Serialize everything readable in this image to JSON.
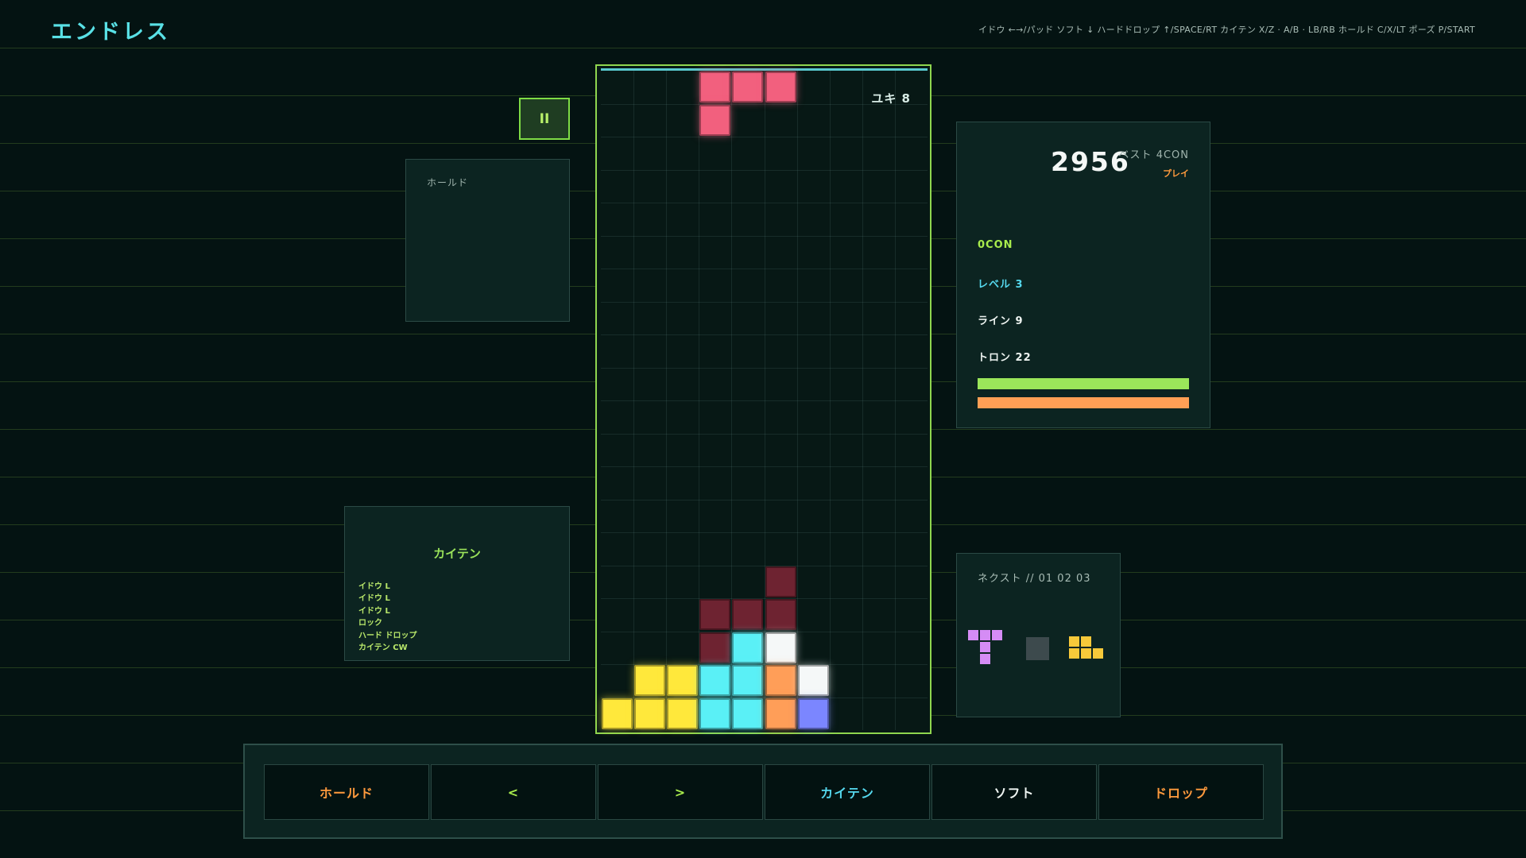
{
  "header": {
    "title": "エンドレス",
    "controls_hint": "イドウ ←→/パッド ソフト ↓ ハードドロップ ↑/SPACE/RT カイテン X/Z · A/B · LB/RB ホールド C/X/LT ポーズ P/START"
  },
  "pause_button": {
    "label": "II"
  },
  "hold": {
    "label": "ホールド"
  },
  "log": {
    "title": "カイテン",
    "entries": [
      "イドウ L",
      "イドウ L",
      "イドウ L",
      "ロック",
      "ハード ドロップ",
      "カイテン CW"
    ]
  },
  "board": {
    "pieces_label": "ユキ 8",
    "columns": 10,
    "rows": 20,
    "colors": {
      "pink": "#f2607e",
      "maroon": "#6e2331",
      "yellow": "#ffe83b",
      "cyan": "#5af0f6",
      "white": "#f5f8f8",
      "orange": "#ff9e58",
      "blue": "#7b86ff"
    },
    "active_piece": [
      {
        "col": 3,
        "row": 0,
        "color": "pink"
      },
      {
        "col": 4,
        "row": 0,
        "color": "pink"
      },
      {
        "col": 5,
        "row": 0,
        "color": "pink"
      },
      {
        "col": 3,
        "row": 1,
        "color": "pink"
      }
    ],
    "locked": [
      {
        "col": 5,
        "row": 15,
        "color": "maroon"
      },
      {
        "col": 3,
        "row": 16,
        "color": "maroon"
      },
      {
        "col": 4,
        "row": 16,
        "color": "maroon"
      },
      {
        "col": 5,
        "row": 16,
        "color": "maroon"
      },
      {
        "col": 3,
        "row": 17,
        "color": "maroon"
      },
      {
        "col": 4,
        "row": 17,
        "color": "cyan"
      },
      {
        "col": 5,
        "row": 17,
        "color": "white"
      },
      {
        "col": 1,
        "row": 18,
        "color": "yellow"
      },
      {
        "col": 2,
        "row": 18,
        "color": "yellow"
      },
      {
        "col": 3,
        "row": 18,
        "color": "cyan"
      },
      {
        "col": 4,
        "row": 18,
        "color": "cyan"
      },
      {
        "col": 5,
        "row": 18,
        "color": "orange"
      },
      {
        "col": 6,
        "row": 18,
        "color": "white"
      },
      {
        "col": 0,
        "row": 19,
        "color": "yellow"
      },
      {
        "col": 1,
        "row": 19,
        "color": "yellow"
      },
      {
        "col": 2,
        "row": 19,
        "color": "yellow"
      },
      {
        "col": 3,
        "row": 19,
        "color": "cyan"
      },
      {
        "col": 4,
        "row": 19,
        "color": "cyan"
      },
      {
        "col": 5,
        "row": 19,
        "color": "orange"
      },
      {
        "col": 6,
        "row": 19,
        "color": "blue"
      }
    ]
  },
  "stats": {
    "score": "2956",
    "best": "ベスト 4CON",
    "mode": "プレイ",
    "combo": "0CON",
    "level": "レベル  3",
    "lines": "ライン  9",
    "tron": "トロン  22",
    "green_bar_fraction": 1.0,
    "orange_bar_fraction": 1.0
  },
  "next": {
    "label": "ネクスト // 01 02 03",
    "queue": [
      {
        "piece": "T",
        "color": "#d58cf5"
      },
      {
        "piece": "O",
        "color": "#3d4a4d"
      },
      {
        "piece": "Z",
        "color": "#f7c93a"
      }
    ]
  },
  "controls": [
    {
      "label": "ホールド",
      "color": "#ff9a3d",
      "name": "hold-button"
    },
    {
      "label": "<",
      "color": "#a8ec4c",
      "name": "move-left-button"
    },
    {
      "label": ">",
      "color": "#a8ec4c",
      "name": "move-right-button"
    },
    {
      "label": "カイテン",
      "color": "#55d8ee",
      "name": "rotate-button"
    },
    {
      "label": "ソフト",
      "color": "#eef4f1",
      "name": "soft-drop-button"
    },
    {
      "label": "ドロップ",
      "color": "#ff9a3d",
      "name": "hard-drop-button"
    }
  ]
}
